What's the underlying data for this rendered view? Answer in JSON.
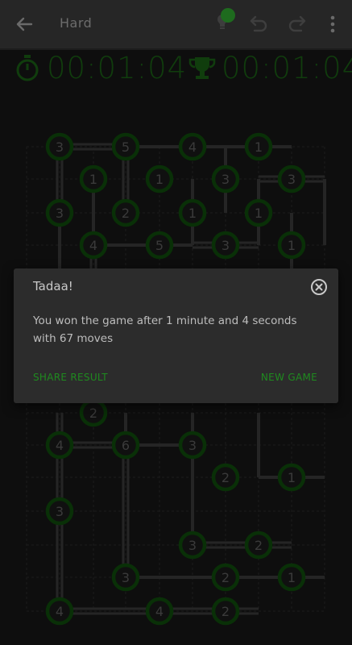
{
  "header": {
    "title": "Hard",
    "hint_badge_color": "#1e6b1e"
  },
  "timers": {
    "elapsed": "00:01:04",
    "best": "00:01:04"
  },
  "colors": {
    "accent": "#1a5e14",
    "node_ring": "#0f4a0c",
    "node_fill": "#191919",
    "bridge": "#3a3a3a"
  },
  "board": {
    "rows": [
      {
        "cells": [
          "3",
          "",
          "5",
          "",
          "4",
          "",
          "1",
          ""
        ]
      },
      {
        "cells": [
          "",
          "1",
          "",
          "1",
          "",
          "3",
          "",
          "3"
        ]
      },
      {
        "cells": [
          "3",
          "",
          "2",
          "",
          "1",
          "",
          "1",
          ""
        ]
      },
      {
        "cells": [
          "",
          "4",
          "",
          "5",
          "",
          "3",
          "",
          "1"
        ]
      },
      {
        "cells": [
          "",
          "",
          "",
          "",
          "",
          "",
          "",
          ""
        ]
      },
      {
        "cells": [
          "",
          "",
          "",
          "",
          "",
          "",
          "",
          ""
        ]
      },
      {
        "cells": [
          "",
          "",
          "",
          "",
          "",
          "",
          "",
          ""
        ]
      },
      {
        "cells": [
          "",
          "2",
          "",
          "",
          "",
          "",
          "",
          ""
        ]
      },
      {
        "cells": [
          "4",
          "",
          "6",
          "",
          "3",
          "",
          "",
          ""
        ]
      },
      {
        "cells": [
          "",
          "",
          "",
          "",
          "",
          "2",
          "",
          "1"
        ]
      },
      {
        "cells": [
          "3",
          "",
          "",
          "",
          "",
          "",
          "",
          ""
        ]
      },
      {
        "cells": [
          "",
          "",
          "",
          "",
          "3",
          "",
          "2",
          ""
        ]
      },
      {
        "cells": [
          "",
          "",
          "3",
          "",
          "",
          "2",
          "",
          "1"
        ]
      },
      {
        "cells": [
          "4",
          "",
          "",
          "4",
          "",
          "2",
          "",
          ""
        ]
      }
    ]
  },
  "dialog": {
    "title": "Tadaa!",
    "message": "You won the game after 1 minute and 4 seconds with 67 moves",
    "share_label": "SHARE RESULT",
    "new_game_label": "NEW GAME"
  }
}
